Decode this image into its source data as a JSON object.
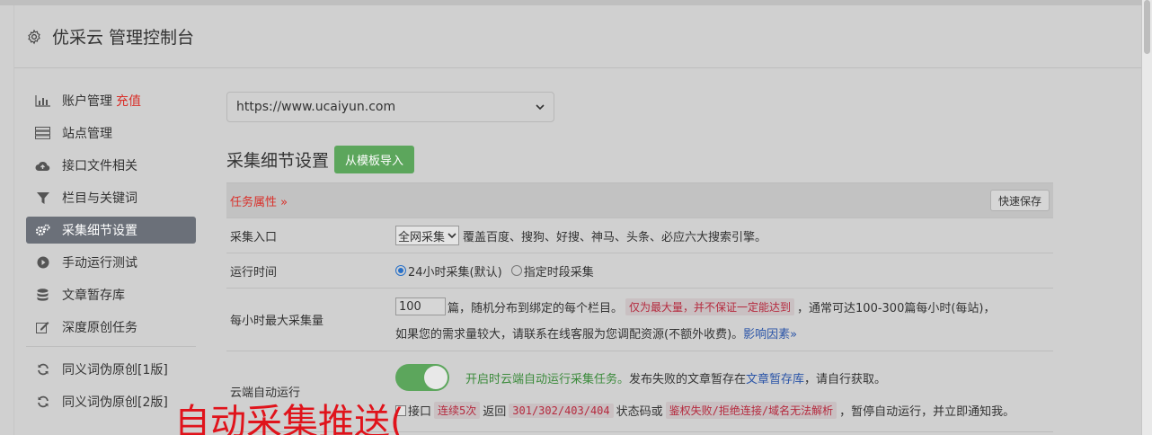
{
  "header": {
    "title": "优采云 管理控制台"
  },
  "sidebar": {
    "items": [
      {
        "label": "账户管理",
        "extra": "充值"
      },
      {
        "label": "站点管理"
      },
      {
        "label": "接口文件相关"
      },
      {
        "label": "栏目与关键词"
      },
      {
        "label": "采集细节设置"
      },
      {
        "label": "手动运行测试"
      },
      {
        "label": "文章暂存库"
      },
      {
        "label": "深度原创任务"
      },
      {
        "label": "同义词伪原创[1版]"
      },
      {
        "label": "同义词伪原创[2版]"
      }
    ]
  },
  "site_select": {
    "value": "https://www.ucaiyun.com"
  },
  "section": {
    "title": "采集细节设置",
    "import_button": "从模板导入"
  },
  "task_table": {
    "header_label": "任务属性 »",
    "save_button": "快速保存",
    "rows": {
      "entry": {
        "key": "采集入口",
        "select_value": "全网采集",
        "desc": "覆盖百度、搜狗、好搜、神马、头条、必应六大搜索引擎。"
      },
      "runtime": {
        "key": "运行时间",
        "opt1": "24小时采集(默认)",
        "opt2": "指定时段采集"
      },
      "max_per_hour": {
        "key": "每小时最大采集量",
        "value": "100",
        "t1": "篇，随机分布到绑定的每个栏目。",
        "red": "仅为最大量，并不保证一定能达到",
        "t2": "，通常可达100-300篇每小时(每站)，",
        "t3": "如果您的需求量较大，请联系在线客服为您调配资源(不额外收费)。",
        "link": "影响因素»"
      },
      "cloud": {
        "key": "云端自动运行",
        "green": "开启时云端自动运行采集任务。",
        "t1": "发布失败的文章暂存在",
        "link": "文章暂存库",
        "t2": "，请自行获取。",
        "c1": "接口",
        "c_red1": "连续5次",
        "c2": "返回",
        "c_red2": "301/302/403/404",
        "c3": "状态码或",
        "c_red3": "鉴权失败/拒绝连接/域名无法解析",
        "c4": "，暂停自动运行，并立即通知我。"
      }
    }
  },
  "overlay_text": "自动采集推送("
}
